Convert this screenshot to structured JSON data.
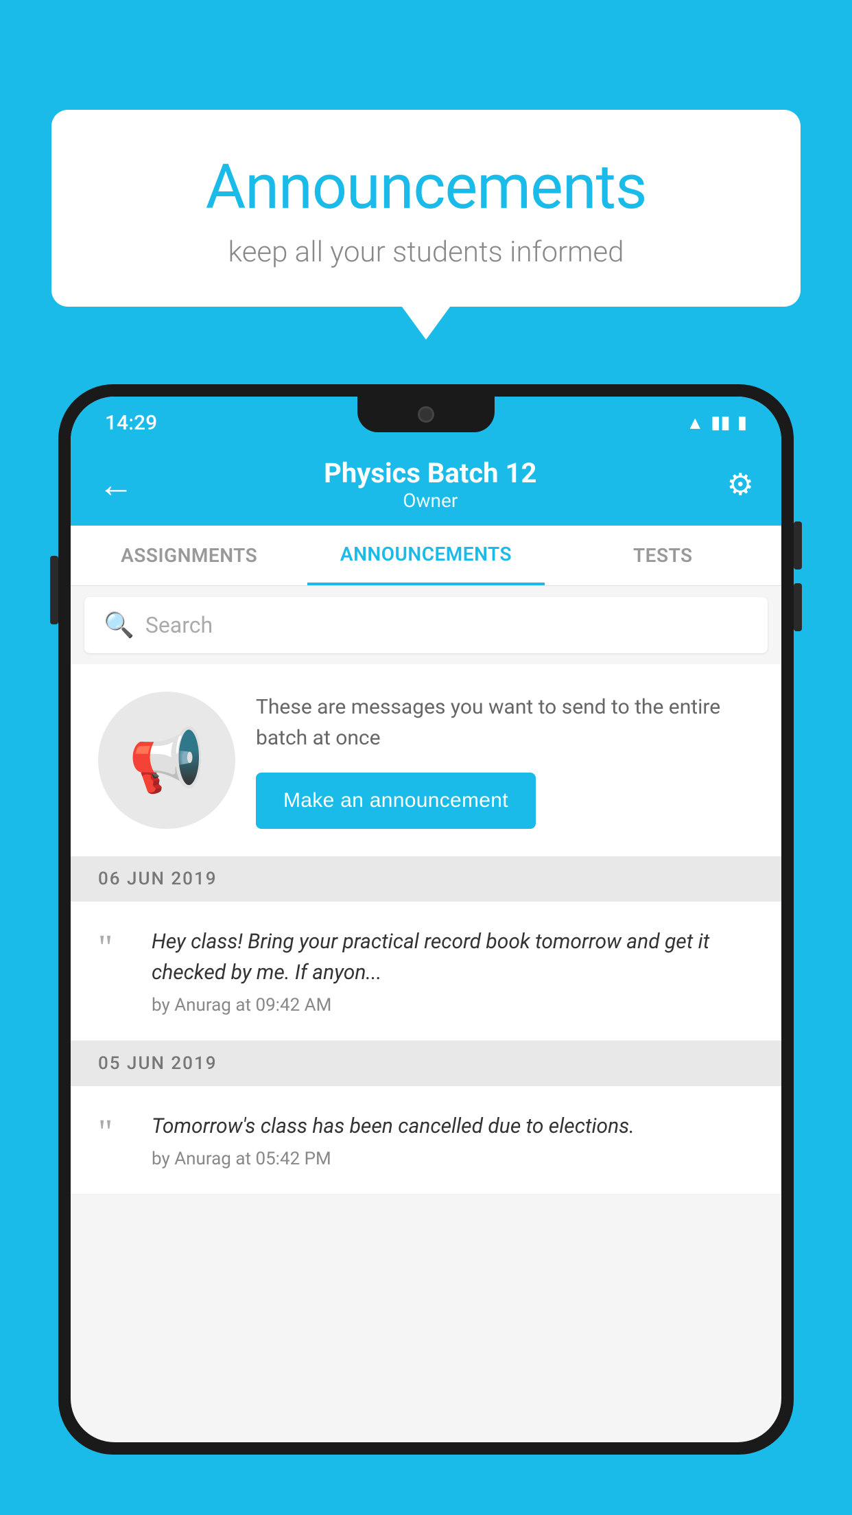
{
  "background_color": "#1ABBE8",
  "speech_bubble": {
    "title": "Announcements",
    "subtitle": "keep all your students informed"
  },
  "phone": {
    "status_bar": {
      "time": "14:29",
      "icons": [
        "wifi",
        "signal",
        "battery"
      ]
    },
    "app_bar": {
      "back_icon": "back-arrow",
      "title": "Physics Batch 12",
      "subtitle": "Owner",
      "settings_icon": "gear"
    },
    "tabs": [
      {
        "label": "ASSIGNMENTS",
        "active": false
      },
      {
        "label": "ANNOUNCEMENTS",
        "active": true
      },
      {
        "label": "TESTS",
        "active": false
      }
    ],
    "search": {
      "placeholder": "Search"
    },
    "announcement_prompt": {
      "description": "These are messages you want to send to the entire batch at once",
      "button_label": "Make an announcement"
    },
    "messages": [
      {
        "date": "06  JUN  2019",
        "text": "Hey class! Bring your practical record book tomorrow and get it checked by me. If anyon...",
        "author": "by Anurag at 09:42 AM"
      },
      {
        "date": "05  JUN  2019",
        "text": "Tomorrow's class has been cancelled due to elections.",
        "author": "by Anurag at 05:42 PM"
      }
    ]
  }
}
